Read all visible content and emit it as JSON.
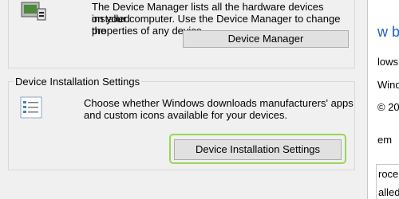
{
  "device_manager": {
    "description_lines": [
      "The Device Manager lists all the hardware devices installed",
      "on your computer. Use the Device Manager to change the",
      "properties of any device."
    ],
    "button_label": "Device Manager"
  },
  "installation": {
    "group_title": "Device Installation Settings",
    "description_lines": [
      "Choose whether Windows downloads manufacturers' apps",
      "and custom icons available for your devices."
    ],
    "button_label": "Device Installation Settings"
  },
  "background_window": {
    "texts": [
      "w ba",
      "lows",
      "Windo",
      "© 20",
      "em",
      "roce",
      "alled"
    ]
  },
  "colors": {
    "focus_ring": "#9bd45a",
    "link": "#1f5fbf"
  }
}
